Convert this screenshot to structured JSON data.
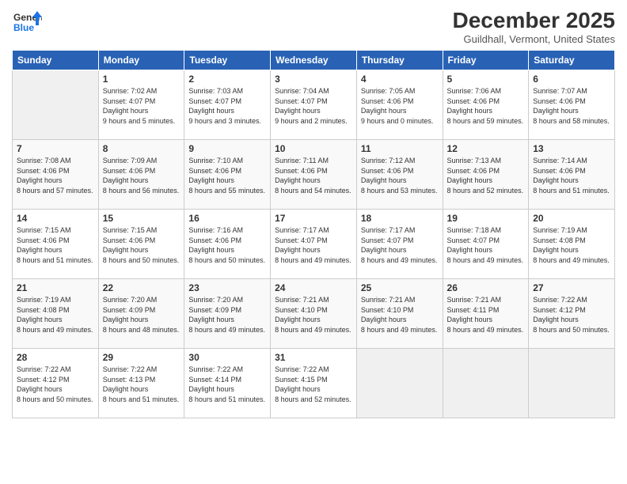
{
  "header": {
    "logo": {
      "general": "General",
      "blue": "Blue"
    },
    "title": "December 2025",
    "subtitle": "Guildhall, Vermont, United States"
  },
  "weekdays": [
    "Sunday",
    "Monday",
    "Tuesday",
    "Wednesday",
    "Thursday",
    "Friday",
    "Saturday"
  ],
  "weeks": [
    [
      {
        "day": "",
        "empty": true
      },
      {
        "day": "1",
        "sunrise": "7:02 AM",
        "sunset": "4:07 PM",
        "daylight": "9 hours and 5 minutes."
      },
      {
        "day": "2",
        "sunrise": "7:03 AM",
        "sunset": "4:07 PM",
        "daylight": "9 hours and 3 minutes."
      },
      {
        "day": "3",
        "sunrise": "7:04 AM",
        "sunset": "4:07 PM",
        "daylight": "9 hours and 2 minutes."
      },
      {
        "day": "4",
        "sunrise": "7:05 AM",
        "sunset": "4:06 PM",
        "daylight": "9 hours and 0 minutes."
      },
      {
        "day": "5",
        "sunrise": "7:06 AM",
        "sunset": "4:06 PM",
        "daylight": "8 hours and 59 minutes."
      },
      {
        "day": "6",
        "sunrise": "7:07 AM",
        "sunset": "4:06 PM",
        "daylight": "8 hours and 58 minutes."
      }
    ],
    [
      {
        "day": "7",
        "sunrise": "7:08 AM",
        "sunset": "4:06 PM",
        "daylight": "8 hours and 57 minutes."
      },
      {
        "day": "8",
        "sunrise": "7:09 AM",
        "sunset": "4:06 PM",
        "daylight": "8 hours and 56 minutes."
      },
      {
        "day": "9",
        "sunrise": "7:10 AM",
        "sunset": "4:06 PM",
        "daylight": "8 hours and 55 minutes."
      },
      {
        "day": "10",
        "sunrise": "7:11 AM",
        "sunset": "4:06 PM",
        "daylight": "8 hours and 54 minutes."
      },
      {
        "day": "11",
        "sunrise": "7:12 AM",
        "sunset": "4:06 PM",
        "daylight": "8 hours and 53 minutes."
      },
      {
        "day": "12",
        "sunrise": "7:13 AM",
        "sunset": "4:06 PM",
        "daylight": "8 hours and 52 minutes."
      },
      {
        "day": "13",
        "sunrise": "7:14 AM",
        "sunset": "4:06 PM",
        "daylight": "8 hours and 51 minutes."
      }
    ],
    [
      {
        "day": "14",
        "sunrise": "7:15 AM",
        "sunset": "4:06 PM",
        "daylight": "8 hours and 51 minutes."
      },
      {
        "day": "15",
        "sunrise": "7:15 AM",
        "sunset": "4:06 PM",
        "daylight": "8 hours and 50 minutes."
      },
      {
        "day": "16",
        "sunrise": "7:16 AM",
        "sunset": "4:06 PM",
        "daylight": "8 hours and 50 minutes."
      },
      {
        "day": "17",
        "sunrise": "7:17 AM",
        "sunset": "4:07 PM",
        "daylight": "8 hours and 49 minutes."
      },
      {
        "day": "18",
        "sunrise": "7:17 AM",
        "sunset": "4:07 PM",
        "daylight": "8 hours and 49 minutes."
      },
      {
        "day": "19",
        "sunrise": "7:18 AM",
        "sunset": "4:07 PM",
        "daylight": "8 hours and 49 minutes."
      },
      {
        "day": "20",
        "sunrise": "7:19 AM",
        "sunset": "4:08 PM",
        "daylight": "8 hours and 49 minutes."
      }
    ],
    [
      {
        "day": "21",
        "sunrise": "7:19 AM",
        "sunset": "4:08 PM",
        "daylight": "8 hours and 49 minutes."
      },
      {
        "day": "22",
        "sunrise": "7:20 AM",
        "sunset": "4:09 PM",
        "daylight": "8 hours and 48 minutes."
      },
      {
        "day": "23",
        "sunrise": "7:20 AM",
        "sunset": "4:09 PM",
        "daylight": "8 hours and 49 minutes."
      },
      {
        "day": "24",
        "sunrise": "7:21 AM",
        "sunset": "4:10 PM",
        "daylight": "8 hours and 49 minutes."
      },
      {
        "day": "25",
        "sunrise": "7:21 AM",
        "sunset": "4:10 PM",
        "daylight": "8 hours and 49 minutes."
      },
      {
        "day": "26",
        "sunrise": "7:21 AM",
        "sunset": "4:11 PM",
        "daylight": "8 hours and 49 minutes."
      },
      {
        "day": "27",
        "sunrise": "7:22 AM",
        "sunset": "4:12 PM",
        "daylight": "8 hours and 50 minutes."
      }
    ],
    [
      {
        "day": "28",
        "sunrise": "7:22 AM",
        "sunset": "4:12 PM",
        "daylight": "8 hours and 50 minutes."
      },
      {
        "day": "29",
        "sunrise": "7:22 AM",
        "sunset": "4:13 PM",
        "daylight": "8 hours and 51 minutes."
      },
      {
        "day": "30",
        "sunrise": "7:22 AM",
        "sunset": "4:14 PM",
        "daylight": "8 hours and 51 minutes."
      },
      {
        "day": "31",
        "sunrise": "7:22 AM",
        "sunset": "4:15 PM",
        "daylight": "8 hours and 52 minutes."
      },
      {
        "day": "",
        "empty": true
      },
      {
        "day": "",
        "empty": true
      },
      {
        "day": "",
        "empty": true
      }
    ]
  ]
}
